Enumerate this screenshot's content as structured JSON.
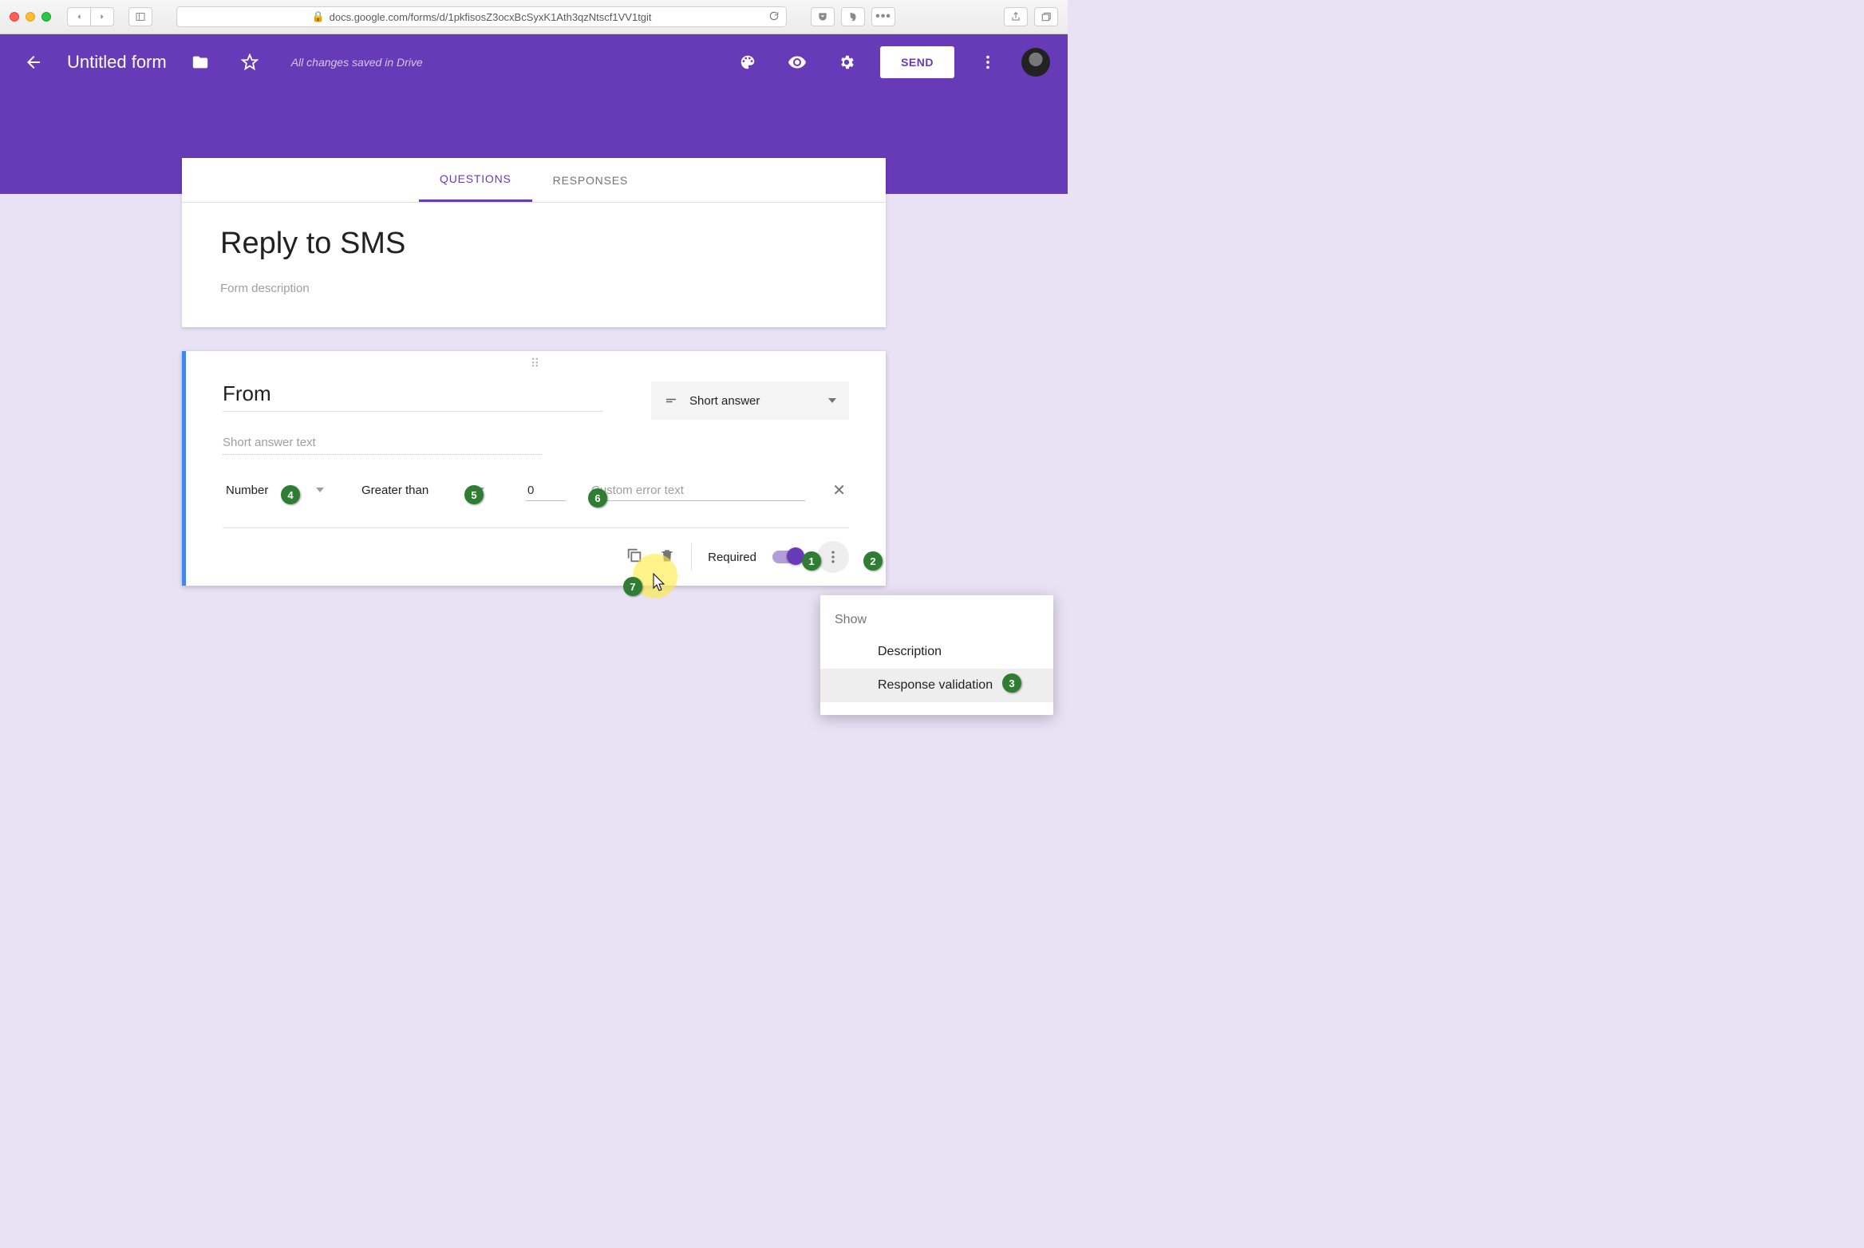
{
  "browser": {
    "url": "docs.google.com/forms/d/1pkfisosZ3ocxBcSyxK1Ath3qzNtscf1VV1tgit"
  },
  "header": {
    "title": "Untitled form",
    "save_status": "All changes saved in Drive",
    "send_label": "SEND"
  },
  "tabs": {
    "questions": "QUESTIONS",
    "responses": "RESPONSES",
    "active": "questions"
  },
  "form": {
    "title": "Reply to SMS",
    "description_placeholder": "Form description"
  },
  "question": {
    "title": "From",
    "type_label": "Short answer",
    "answer_placeholder": "Short answer text",
    "validation": {
      "type": "Number",
      "condition": "Greater than",
      "value": "0",
      "error_placeholder": "Custom error text"
    },
    "footer": {
      "required_label": "Required",
      "required_on": true
    }
  },
  "popup": {
    "header": "Show",
    "items": [
      "Description",
      "Response validation"
    ]
  },
  "annotations": {
    "b1": "1",
    "b2": "2",
    "b3": "3",
    "b4": "4",
    "b5": "5",
    "b6": "6",
    "b7": "7"
  }
}
